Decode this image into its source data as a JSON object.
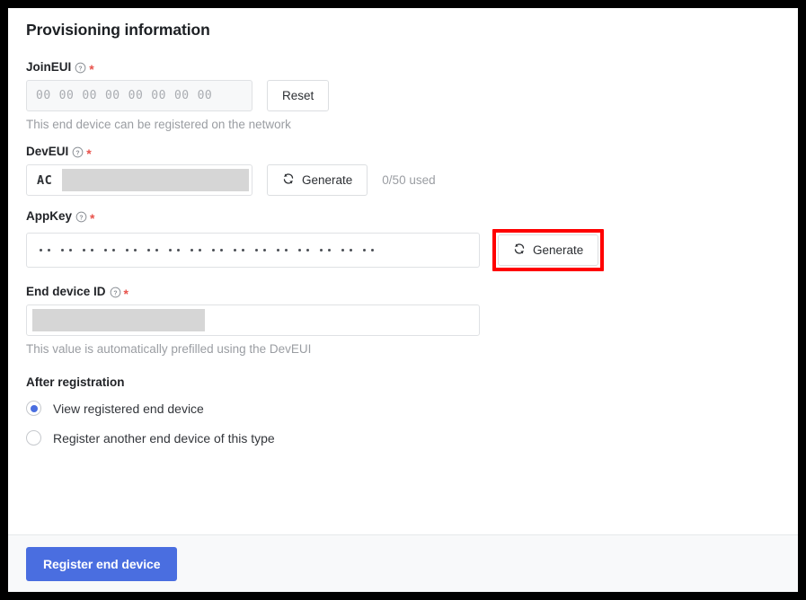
{
  "page": {
    "title": "Provisioning information"
  },
  "fields": {
    "join_eui": {
      "label": "JoinEUI",
      "help_icon": "question-circle-icon",
      "required_marker": "*",
      "bytes": [
        "00",
        "00",
        "00",
        "00",
        "00",
        "00",
        "00",
        "00"
      ],
      "reset_label": "Reset",
      "help_text": "This end device can be registered on the network"
    },
    "dev_eui": {
      "label": "DevEUI",
      "help_icon": "question-circle-icon",
      "required_marker": "*",
      "prefix": "AC",
      "value": "",
      "generate_label": "Generate",
      "generate_icon": "refresh-icon",
      "used_count": "0/50 used"
    },
    "app_key": {
      "label": "AppKey",
      "help_icon": "question-circle-icon",
      "required_marker": "*",
      "masked_groups": 16,
      "dots_per_group": 2,
      "generate_label": "Generate",
      "generate_icon": "refresh-icon",
      "highlighted": true,
      "highlight_color": "#ff0000"
    },
    "end_device_id": {
      "label": "End device ID",
      "help_icon": "question-circle-icon",
      "required_marker": "*",
      "value": "",
      "help_text": "This value is automatically prefilled using the DevEUI"
    }
  },
  "after_registration": {
    "title": "After registration",
    "options": [
      {
        "label": "View registered end device",
        "selected": true
      },
      {
        "label": "Register another end device of this type",
        "selected": false
      }
    ]
  },
  "footer": {
    "submit_label": "Register end device",
    "submit_color": "#4a6ee0"
  }
}
